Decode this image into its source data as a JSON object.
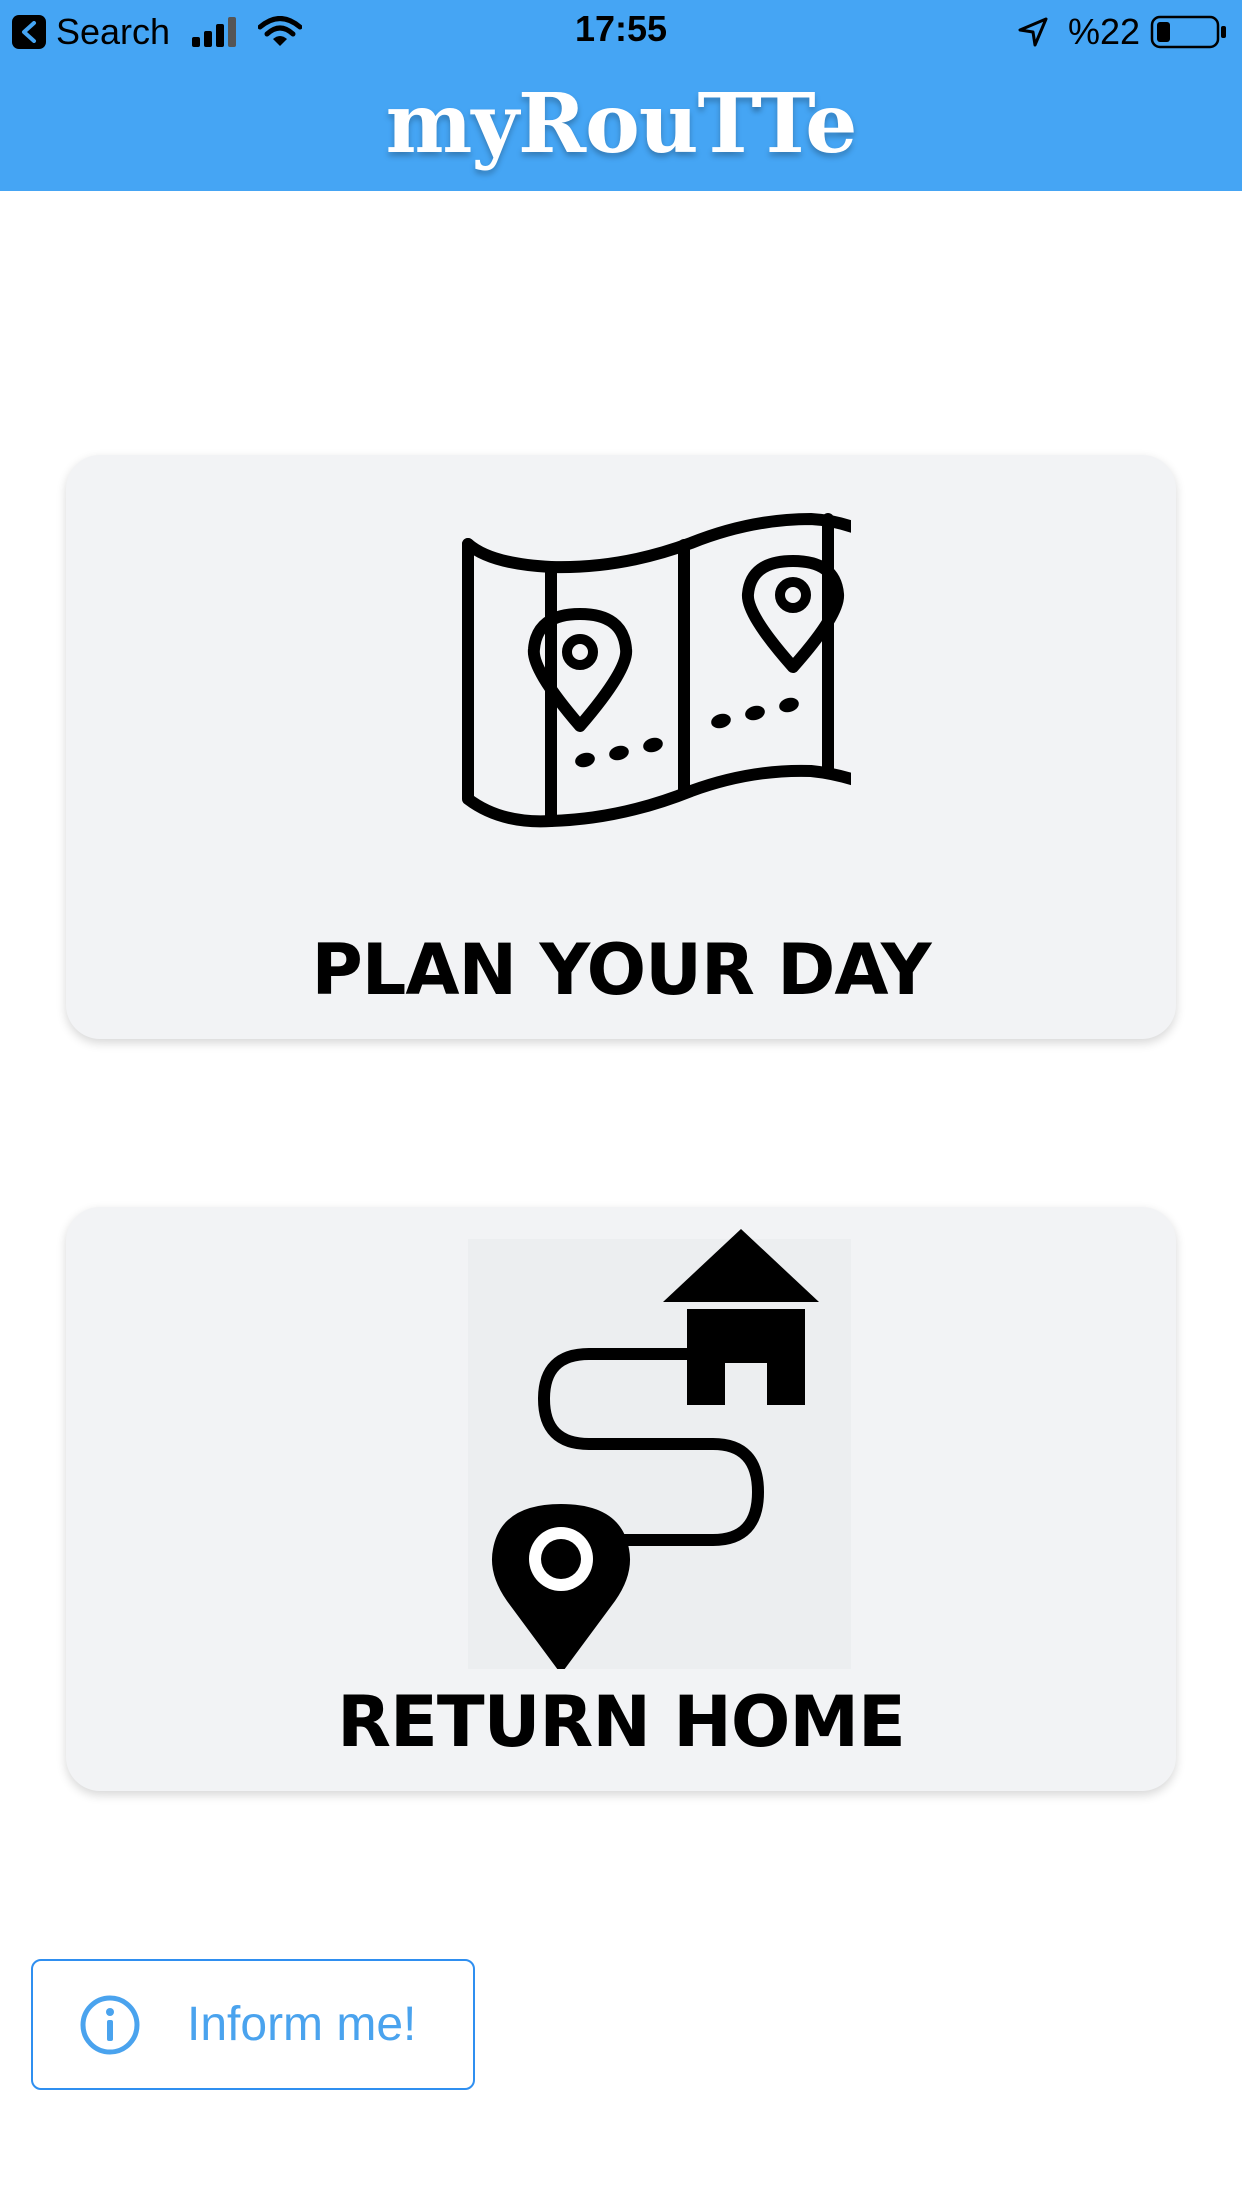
{
  "status_bar": {
    "back_label": "Search",
    "time": "17:55",
    "battery": "%22",
    "icons": [
      "back-arrow-icon",
      "signal-icon",
      "wifi-icon",
      "location-arrow-icon",
      "battery-icon"
    ]
  },
  "header": {
    "title": "myRouTTe",
    "background_color": "#45a5f4"
  },
  "cards": {
    "plan": {
      "label": "PLAN YOUR DAY",
      "icon": "map-pins-icon"
    },
    "home": {
      "label": "RETURN HOME",
      "icon": "route-home-icon"
    }
  },
  "inform": {
    "label": "Inform me!",
    "icon": "info-icon",
    "accent_color": "#2f8ff0"
  },
  "battery_level": 0.22
}
